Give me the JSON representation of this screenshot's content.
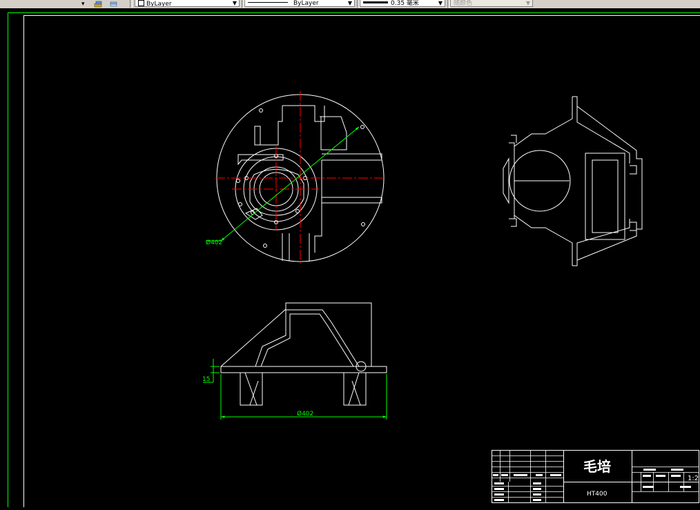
{
  "toolbar": {
    "layer_color_combo": {
      "value": "ByLayer"
    },
    "linetype_combo": {
      "value": "ByLayer"
    },
    "lineweight_combo": {
      "value": "0.35 毫米"
    },
    "plotstyle_combo": {
      "value": "随颜色"
    }
  },
  "drawing": {
    "dim_diameter_top": "Ø402",
    "dim_diameter_bottom": "Ø402",
    "dim_thickness": "15",
    "title_block": {
      "part_name": "毛培",
      "material": "HT400",
      "scale": "1:2"
    }
  },
  "colors": {
    "background": "#000000",
    "geometry": "#ffffff",
    "centerline": "#ff0000",
    "dimension": "#00ff00"
  }
}
